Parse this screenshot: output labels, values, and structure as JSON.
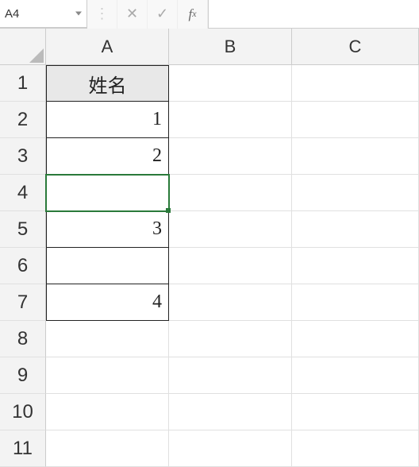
{
  "name_box": "A4",
  "formula_input": "",
  "icons": {
    "cancel": "✕",
    "enter": "✓",
    "fx": "fx"
  },
  "columns": [
    "A",
    "B",
    "C"
  ],
  "rows": [
    "1",
    "2",
    "3",
    "4",
    "5",
    "6",
    "7",
    "8",
    "9",
    "10",
    "11"
  ],
  "cells": {
    "A1": "姓名",
    "A2": "1",
    "A3": "2",
    "A4": "",
    "A5": "3",
    "A6": "",
    "A7": "4"
  },
  "selected_cell": "A4"
}
